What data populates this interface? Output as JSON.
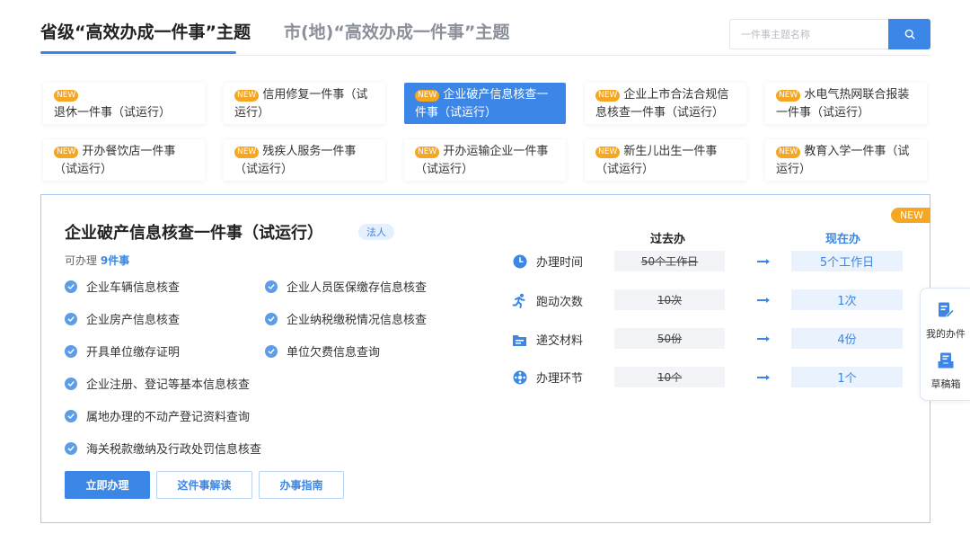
{
  "header": {
    "tab_province": "省级“高效办成一件事”主题",
    "tab_city": "市(地)“高效办成一件事”主题",
    "search_placeholder": "一件事主题名称"
  },
  "badge_text": "NEW",
  "topics": [
    {
      "label": "退休一件事（试运行）",
      "is_new": true,
      "selected": false
    },
    {
      "label": "信用修复一件事（试运行）",
      "is_new": true,
      "selected": false
    },
    {
      "label": "企业破产信息核查一件事（试运行）",
      "is_new": true,
      "selected": true
    },
    {
      "label": "企业上市合法合规信息核查一件事（试运行）",
      "is_new": true,
      "selected": false
    },
    {
      "label": "水电气热网联合报装一件事（试运行）",
      "is_new": true,
      "selected": false
    },
    {
      "label": "开办餐饮店一件事（试运行）",
      "is_new": true,
      "selected": false
    },
    {
      "label": "残疾人服务一件事（试运行）",
      "is_new": true,
      "selected": false
    },
    {
      "label": "开办运输企业一件事（试运行）",
      "is_new": true,
      "selected": false
    },
    {
      "label": "新生儿出生一件事（试运行）",
      "is_new": true,
      "selected": false
    },
    {
      "label": "教育入学一件事（试运行）",
      "is_new": true,
      "selected": false
    }
  ],
  "detail": {
    "new_badge": "NEW",
    "title": "企业破产信息核查一件事（试运行）",
    "tag": "法人",
    "count_prefix": "可办理",
    "count_value": "9件事",
    "items": [
      "企业车辆信息核查",
      "企业人员医保缴存信息核查",
      "企业房产信息核查",
      "企业纳税缴税情况信息核查",
      "开具单位缴存证明",
      "单位欠费信息查询",
      "企业注册、登记等基本信息核查",
      "属地办理的不动产登记资料查询",
      "海关税款缴纳及行政处罚信息核查"
    ],
    "buttons": {
      "apply": "立即办理",
      "interpret": "这件事解读",
      "guide": "办事指南"
    },
    "comparison": {
      "past_header": "过去办",
      "now_header": "现在办",
      "accent_color": "#3b86e6",
      "rows": [
        {
          "icon": "clock-icon",
          "label": "办理时间",
          "past": "50个工作日",
          "now": "5个工作日"
        },
        {
          "icon": "running-icon",
          "label": "跑动次数",
          "past": "10次",
          "now": "1次"
        },
        {
          "icon": "folder-icon",
          "label": "递交材料",
          "past": "50份",
          "now": "4份"
        },
        {
          "icon": "process-icon",
          "label": "办理环节",
          "past": "10个",
          "now": "1个"
        }
      ]
    }
  },
  "side_widget": {
    "my_items": "我的办件",
    "drafts": "草稿箱"
  },
  "colors": {
    "primary": "#3b86e6",
    "badge": "#f5a623"
  }
}
